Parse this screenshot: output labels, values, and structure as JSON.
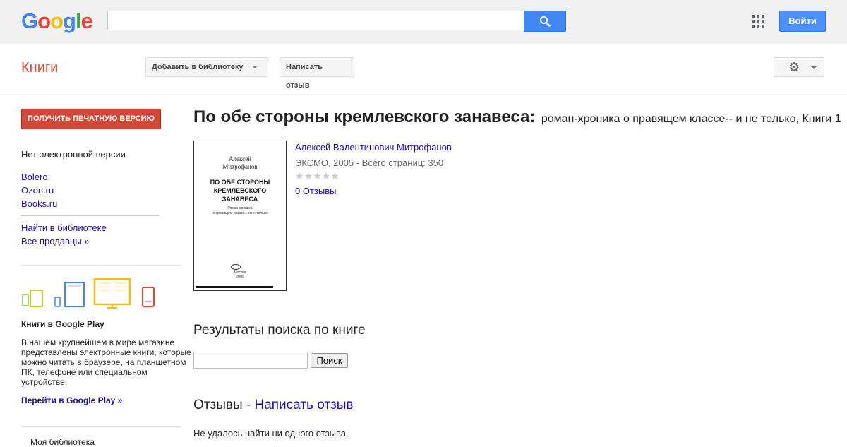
{
  "header": {
    "logo": "Google",
    "search": {
      "value": "",
      "placeholder": ""
    },
    "login_label": "Войти"
  },
  "subheader": {
    "section_title": "Книги",
    "add_to_library_label": "Добавить в библиотеку",
    "write_review_label": "Написать отзыв"
  },
  "sidebar": {
    "buy_print_label": "ПОЛУЧИТЬ ПЕЧАТНУЮ ВЕРСИЮ",
    "no_ebook": "Нет электронной версии",
    "sellers": [
      "Bolero",
      "Ozon.ru",
      "Books.ru"
    ],
    "find_in_library": "Найти в библиотеке",
    "all_sellers": "Все продавцы »",
    "play_title": "Книги в Google Play",
    "play_desc": "В нашем крупнейшем в мире магазине представлены электронные книги, которые можно читать в браузере, на планшетном ПК, телефоне или специальном устройстве.",
    "play_link": "Перейти в Google Play »",
    "my_library": "Моя библиотека"
  },
  "book": {
    "title": "По обе стороны кремлевского занавеса:",
    "subtitle": "роман-хроника о правящем классе-- и не только, Книги 1",
    "author": "Алексей Валентинович Митрофанов",
    "publisher_info": "ЭКСМО, 2005 - Всего страниц: 350",
    "rating_stars": 0,
    "reviews_link": "0 Отзывы",
    "cover": {
      "author_line1": "Алексей",
      "author_line2": "Митрофанов",
      "title_line1": "ПО ОБЕ СТОРОНЫ",
      "title_line2": "КРЕМЛЕВСКОГО",
      "title_line3": "ЗАНАВЕСА",
      "small_line1": "Роман-хроника",
      "small_line2": "о правящем классе... и не только",
      "pub_city": "Москва",
      "pub_year": "2005"
    }
  },
  "search_in_book": {
    "heading": "Результаты поиска по книге",
    "input_value": "",
    "button_label": "Поиск"
  },
  "reviews": {
    "heading_prefix": "Отзывы - ",
    "heading_link": "Написать отзыв",
    "empty_text": "Не удалось найти ни одного отзыва."
  },
  "colors": {
    "google_blue": "#4285f4",
    "google_red": "#ea4335",
    "google_yellow": "#fbbc05",
    "google_green": "#34a853",
    "books_red": "#dd4b39",
    "link": "#1a0dab"
  }
}
